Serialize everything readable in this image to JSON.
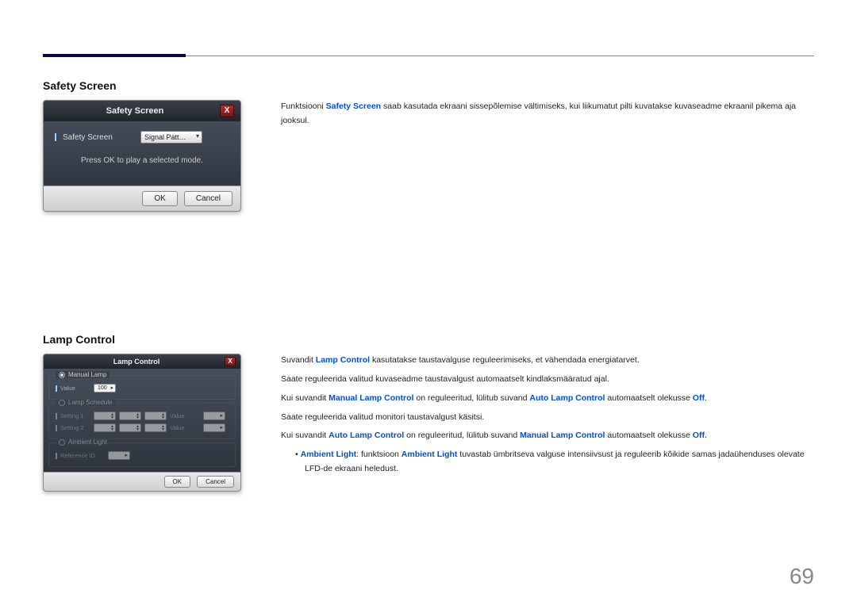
{
  "page_number": "69",
  "safety": {
    "title": "Safety Screen",
    "dialog_title": "Safety Screen",
    "field_label": "Safety Screen",
    "field_value": "Signal Patt…",
    "hint": "Press OK to play a selected mode.",
    "ok": "OK",
    "cancel": "Cancel",
    "desc_pre": "Funktsiooni ",
    "desc_kw": "Safety Screen",
    "desc_post": " saab kasutada ekraani sissepõlemise vältimiseks, kui liikumatut pilti kuvatakse kuvaseadme ekraanil pikema aja jooksul."
  },
  "lamp": {
    "title": "Lamp Control",
    "dialog_title": "Lamp Control",
    "ok": "OK",
    "cancel": "Cancel",
    "group_manual": "Manual Lamp",
    "value_label": "Value",
    "value_num": "100",
    "group_schedule": "Lamp Schedule",
    "sched_row1_label": "Setting 1",
    "sched_row2_label": "Setting 2",
    "sched_value_label": "Value",
    "group_ambient": "Ambient Light",
    "ambient_ref": "Reference ID",
    "p1_pre": "Suvandit ",
    "p1_kw": "Lamp Control",
    "p1_post": " kasutatakse taustavalguse reguleerimiseks, et vähendada energiatarvet.",
    "p2": "Saate reguleerida valitud kuvaseadme taustavalgust automaatselt kindlaksmääratud ajal.",
    "p3_pre": "Kui suvandit ",
    "p3_kw1": "Manual Lamp Control",
    "p3_mid": " on reguleeritud, lülitub suvand ",
    "p3_kw2": "Auto Lamp Control",
    "p3_post": " automaatselt olekusse ",
    "p3_off": "Off",
    "p4": "Saate reguleerida valitud monitori taustavalgust käsitsi.",
    "p5_pre": "Kui suvandit ",
    "p5_kw1": "Auto Lamp Control",
    "p5_mid": " on reguleeritud, lülitub suvand ",
    "p5_kw2": "Manual Lamp Control",
    "p5_post": " automaatselt olekusse ",
    "p5_off": "Off",
    "bullet_kw1": "Ambient Light",
    "bullet_mid": ": funktsioon ",
    "bullet_kw2": "Ambient Light",
    "bullet_post": " tuvastab ümbritseva valguse intensiivsust ja reguleerib kõikide samas jadaühenduses olevate LFD-de ekraani heledust."
  }
}
